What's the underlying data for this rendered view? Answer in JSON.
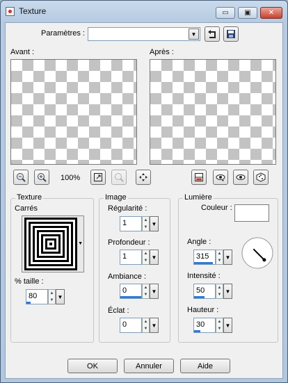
{
  "window": {
    "title": "Texture",
    "minimize_glyph": "▭",
    "maximize_glyph": "▣",
    "close_glyph": "✕"
  },
  "params": {
    "label": "Paramètres :",
    "value": ""
  },
  "preview": {
    "before_label": "Avant :",
    "after_label": "Après :"
  },
  "toolbar": {
    "zoom_percent": "100%"
  },
  "texture": {
    "group_label": "Texture",
    "preset_label": "Carrés",
    "size_label": "% taille :",
    "size_value": "80",
    "size_level": 0.2
  },
  "image": {
    "group_label": "Image",
    "regularity_label": "Régularité :",
    "regularity_value": "1",
    "regularity_level": 0.0,
    "depth_label": "Profondeur :",
    "depth_value": "1",
    "depth_level": 0.0,
    "ambience_label": "Ambiance :",
    "ambience_value": "0",
    "ambience_level": 1.0,
    "glare_label": "Éclat :",
    "glare_value": "0",
    "glare_level": 0.0
  },
  "light": {
    "group_label": "Lumière",
    "color_label": "Couleur :",
    "color_value": "#ffffff",
    "angle_label": "Angle :",
    "angle_value": "315",
    "angle_level": 0.9,
    "intensity_label": "Intensité :",
    "intensity_value": "50",
    "intensity_level": 0.5,
    "height_label": "Hauteur :",
    "height_value": "30",
    "height_level": 0.3
  },
  "buttons": {
    "ok": "OK",
    "cancel": "Annuler",
    "help": "Aide"
  },
  "colors": {
    "accent": "#2f7ad6",
    "checker": "#c3c3c3"
  }
}
